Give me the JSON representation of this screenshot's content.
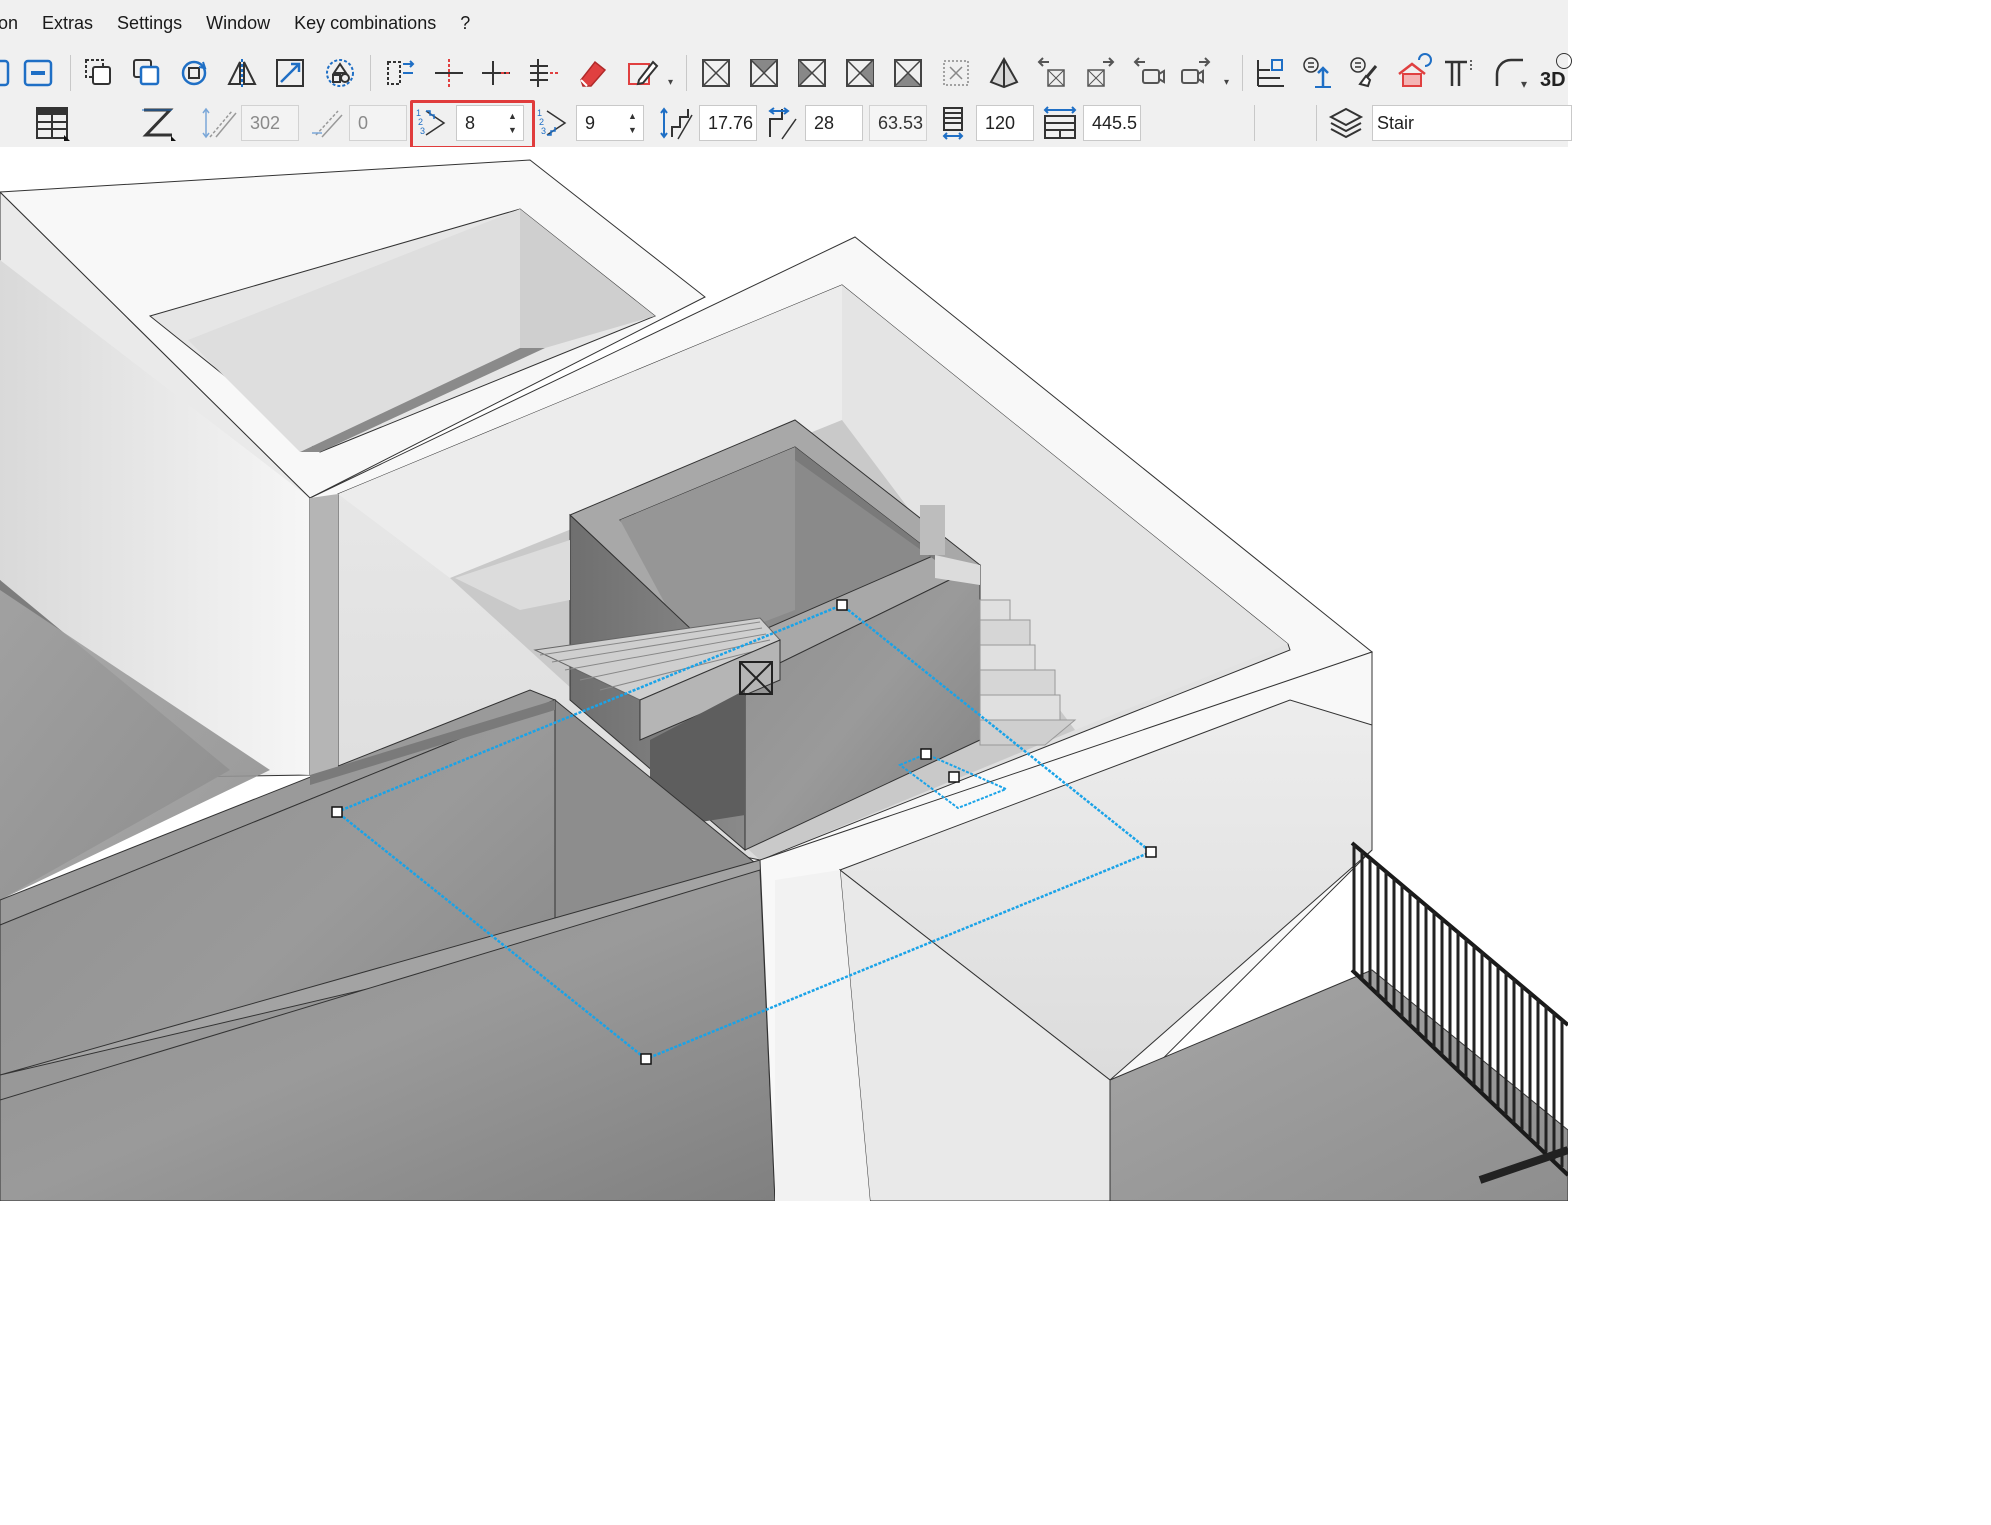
{
  "menu": {
    "items": [
      "ion",
      "Extras",
      "Settings",
      "Window",
      "Key combinations",
      "?"
    ]
  },
  "toolbar1": {
    "label_3d": "3D"
  },
  "stair_params": {
    "total_height": "302",
    "offset": "0",
    "risers_flight1": "8",
    "risers_flight2": "9",
    "riser_height": "17.76",
    "tread_depth": "28",
    "step_rule": "63.53",
    "width": "120",
    "length": "445.5"
  },
  "layer": {
    "name": "Stair"
  },
  "colors": {
    "highlight": "#e03c3c",
    "selection": "#1aa3e8",
    "icon_blue": "#1f6fc5",
    "icon_red": "#e04040",
    "concrete": "#8c8c8c",
    "wall_white": "#f4f4f4"
  }
}
